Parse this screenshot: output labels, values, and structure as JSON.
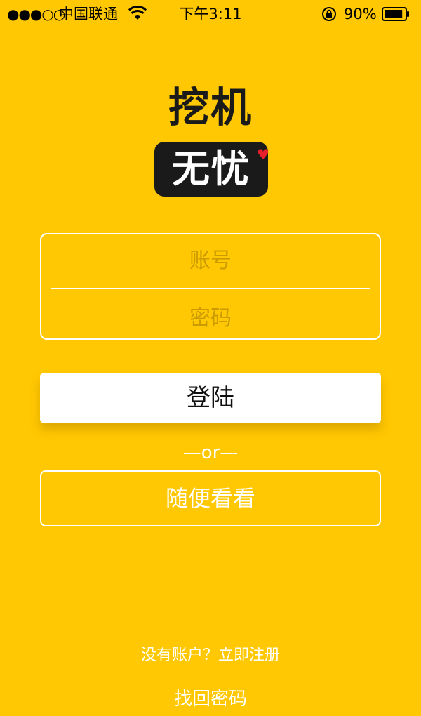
{
  "status_bar": {
    "signal": "●●●○○",
    "carrier": "中国联通",
    "time": "下午3:11",
    "battery_percent": "90%",
    "battery_level": 0.9,
    "icons": [
      "wifi-icon",
      "rotation-lock-icon",
      "battery-icon"
    ]
  },
  "logo": {
    "line1": "挖机",
    "line2": "无忧",
    "heart": "♥"
  },
  "form": {
    "account_placeholder": "账号",
    "password_placeholder": "密码",
    "account_value": "",
    "password_value": "",
    "login_label": "登陆"
  },
  "or_text": "—or—",
  "browse_label": "随便看看",
  "register": {
    "prompt": "没有账户？",
    "link": "立即注册"
  },
  "forgot_password": "找回密码",
  "colors": {
    "background": "#FFC802",
    "logo_dark": "#1a1a1a",
    "heart": "#e8202a",
    "text_light": "#ffffff"
  }
}
